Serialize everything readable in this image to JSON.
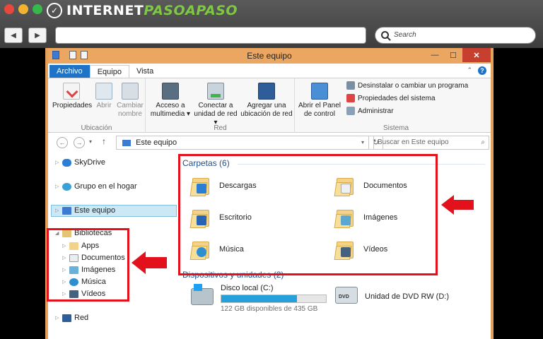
{
  "site": {
    "logo_text_main": "INTERNET",
    "logo_text_accent": "PASOAPASO",
    "search_placeholder": "Search"
  },
  "window": {
    "title": "Este equipo",
    "tabs": [
      "Archivo",
      "Equipo",
      "Vista"
    ],
    "help": "?"
  },
  "ribbon": {
    "groups": [
      {
        "label": "Ubicación",
        "buttons": [
          {
            "label": "Propiedades",
            "enabled": true
          },
          {
            "label": "Abrir",
            "enabled": false
          },
          {
            "label": "Cambiar nombre",
            "enabled": false
          }
        ]
      },
      {
        "label": "Red",
        "buttons": [
          {
            "label": "Acceso a multimedia ▾"
          },
          {
            "label": "Conectar a unidad de red ▾"
          },
          {
            "label": "Agregar una ubicación de red"
          }
        ]
      },
      {
        "label": "Sistema",
        "buttons": [
          {
            "label": "Abrir el Panel de control"
          }
        ],
        "small": [
          "Desinstalar o cambiar un programa",
          "Propiedades del sistema",
          "Administrar"
        ]
      }
    ]
  },
  "address": {
    "path": "Este equipo",
    "search_placeholder": "Buscar en Este equipo"
  },
  "nav": {
    "skydrive": "SkyDrive",
    "grupo": "Grupo en el hogar",
    "este_equipo": "Este equipo",
    "bibliotecas": "Bibliotecas",
    "lib_items": [
      "Apps",
      "Documentos",
      "Imágenes",
      "Música",
      "Vídeos"
    ],
    "red": "Red"
  },
  "content": {
    "folders_header": "Carpetas (6)",
    "folders": [
      "Descargas",
      "Documentos",
      "Escritorio",
      "Imágenes",
      "Música",
      "Vídeos"
    ],
    "devices_header": "Dispositivos y unidades (2)",
    "drives": [
      {
        "name": "Disco local (C:)",
        "info": "122 GB disponibles de 435 GB",
        "fill_fraction": 0.72
      },
      {
        "name": "Unidad de DVD RW (D:)"
      }
    ]
  },
  "colors": {
    "titlebar": "#eba762",
    "accent_blue": "#1e73c6",
    "highlight_red": "#e3111b",
    "logo_accent": "#7ec843"
  }
}
